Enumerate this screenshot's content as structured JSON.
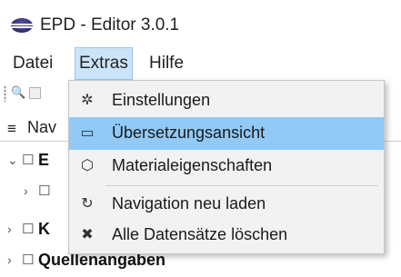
{
  "window": {
    "title": "EPD - Editor 3.0.1",
    "icon": "eclipse-icon"
  },
  "menubar": {
    "items": [
      "Datei",
      "Extras",
      "Hilfe"
    ],
    "active": "Extras"
  },
  "toolbar": {
    "search_glyph": "🔍",
    "icons": [
      "search-icon",
      "save-icon"
    ]
  },
  "panel": {
    "title": "Nav",
    "menu_glyph": "≡"
  },
  "tree": {
    "rows": [
      {
        "twisty": "⌄",
        "folder": "☐",
        "label": "E"
      },
      {
        "twisty": "›",
        "folder": "☐",
        "label": ""
      },
      {
        "twisty": "›",
        "folder": "☐",
        "label": "K"
      },
      {
        "twisty": "›",
        "folder": "☐",
        "label": "Quellenangaben"
      }
    ]
  },
  "dropdown": {
    "items": [
      {
        "icon": "gear-icon",
        "glyph": "✲",
        "label": "Einstellungen",
        "highlight": false
      },
      {
        "icon": "speech-bubble-icon",
        "glyph": "▭",
        "label": "Übersetzungsansicht",
        "highlight": true
      },
      {
        "icon": "cube-icon",
        "glyph": "⬡",
        "label": "Materialeigenschaften",
        "highlight": false
      },
      {
        "icon": "refresh-icon",
        "glyph": "↻",
        "label": "Navigation neu laden",
        "highlight": false
      },
      {
        "icon": "delete-icon",
        "glyph": "✖",
        "label": "Alle Datensätze löschen",
        "highlight": false
      }
    ]
  },
  "colors": {
    "highlight": "#91c9f7",
    "menu_active_bg": "#cce4f7",
    "menu_bg": "#f2f2f2"
  }
}
